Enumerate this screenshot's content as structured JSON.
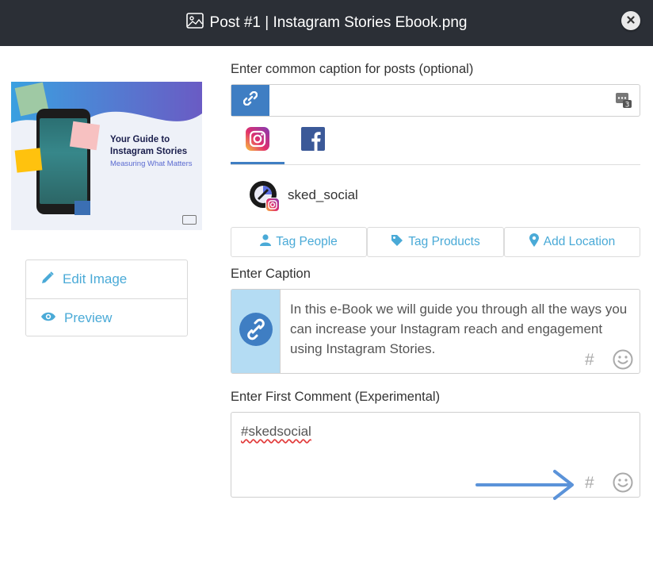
{
  "window": {
    "title": "Post #1 | Instagram Stories Ebook.png",
    "icons": {
      "title_icon": "image-icon",
      "close_icon": "close-icon"
    }
  },
  "thumbnail": {
    "title": "Your Guide to Instagram Stories",
    "subtitle": "Measuring What Matters"
  },
  "actions": [
    {
      "label": "Edit Image",
      "icon": "pencil-icon"
    },
    {
      "label": "Preview",
      "icon": "eye-icon"
    }
  ],
  "common_caption": {
    "label": "Enter common caption for posts (optional)",
    "value": "",
    "counter": "3"
  },
  "platform_tabs": [
    {
      "name": "instagram",
      "active": true
    },
    {
      "name": "facebook",
      "active": false
    }
  ],
  "account": {
    "username": "sked_social"
  },
  "tag_buttons": [
    {
      "label": "Tag People",
      "icon": "person-icon"
    },
    {
      "label": "Tag Products",
      "icon": "tag-icon"
    },
    {
      "label": "Add Location",
      "icon": "location-pin-icon"
    }
  ],
  "caption": {
    "label": "Enter Caption",
    "value": "In this e-Book we will guide you through all the ways you can increase your Instagram reach and engagement using Instagram Stories."
  },
  "first_comment": {
    "label": "Enter First Comment (Experimental)",
    "value": "#skedsocial"
  },
  "colors": {
    "titlebar": "#2b2f36",
    "accent": "#3f7ec3",
    "link_text": "#4aaad7",
    "caption_side": "#b4dcf3"
  }
}
